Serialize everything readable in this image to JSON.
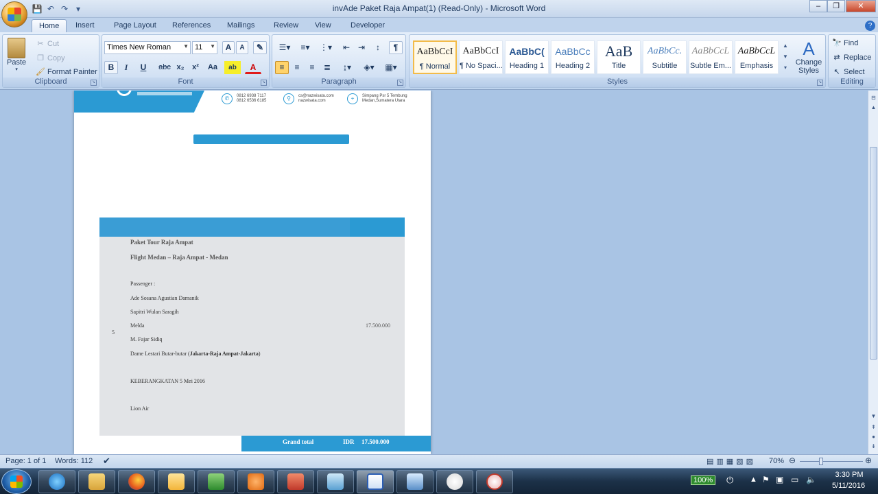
{
  "window": {
    "title": "invAde Paket Raja Ampat(1) (Read-Only) - Microsoft Word",
    "minimize": "–",
    "maximize": "❐",
    "close": "✕"
  },
  "tabs": [
    "Home",
    "Insert",
    "Page Layout",
    "References",
    "Mailings",
    "Review",
    "View",
    "Developer"
  ],
  "clipboard": {
    "label": "Clipboard",
    "paste": "Paste",
    "cut": "Cut",
    "copy": "Copy",
    "format_painter": "Format Painter"
  },
  "font": {
    "label": "Font",
    "name": "Times New Roman",
    "size": "11",
    "grow": "A",
    "shrink": "A",
    "bold": "B",
    "italic": "I",
    "underline": "U",
    "strike": "abc",
    "subscript": "x₂",
    "superscript": "x²",
    "change_case": "Aa",
    "highlight": "ab",
    "color": "A"
  },
  "paragraph": {
    "label": "Paragraph",
    "show_marks": "¶"
  },
  "styles": {
    "label": "Styles",
    "items": [
      {
        "sample": "AaBbCcI",
        "name": "¶ Normal"
      },
      {
        "sample": "AaBbCcI",
        "name": "¶ No Spaci..."
      },
      {
        "sample": "AaBbC(",
        "name": "Heading 1"
      },
      {
        "sample": "AaBbCc",
        "name": "Heading 2"
      },
      {
        "sample": "AaB",
        "name": "Title"
      },
      {
        "sample": "AaBbCc.",
        "name": "Subtitle"
      },
      {
        "sample": "AaBbCcL",
        "name": "Subtle Em..."
      },
      {
        "sample": "AaBbCcL",
        "name": "Emphasis"
      }
    ],
    "change_styles_line1": "Change",
    "change_styles_line2": "Styles"
  },
  "editing": {
    "label": "Editing",
    "find": "Find",
    "replace": "Replace",
    "select": "Select"
  },
  "document": {
    "contacts": [
      {
        "line1": "0812 6938 7117",
        "line2": "0812 6536 6185"
      },
      {
        "line1": "cs@nazwisata.com",
        "line2": "nazwisata.com"
      },
      {
        "line1": "Simpang Psr 5 Tembung",
        "line2": "Medan,Sumatera Utara"
      }
    ],
    "package": "Paket Tour Raja Ampat",
    "flight": "Flight Medan – Raja Ampat - Medan",
    "passenger_label": "Passenger :",
    "passengers": [
      "Ade Sosana Agustian Damanik",
      "Sapitri Wulan Saragih",
      "Melda",
      "M. Fajar Sidiq"
    ],
    "last_passenger_prefix": "Dame Lestari Butar-butar (",
    "last_passenger_route": "Jakarta-Raja Ampat-Jakarta",
    "last_passenger_suffix": ")",
    "quantity": "5",
    "price": "17.500.000",
    "departure": "KEBERANGKATAN 5 Mei 2016",
    "airline": "Lion Air",
    "grand_total_label": "Grand total",
    "currency": "IDR",
    "grand_total_value": "17.500.000"
  },
  "status": {
    "page": "Page: 1 of 1",
    "words": "Words: 112",
    "zoom": "70%"
  },
  "tray": {
    "battery": "100%",
    "time": "3:30 PM",
    "date": "5/11/2016"
  }
}
